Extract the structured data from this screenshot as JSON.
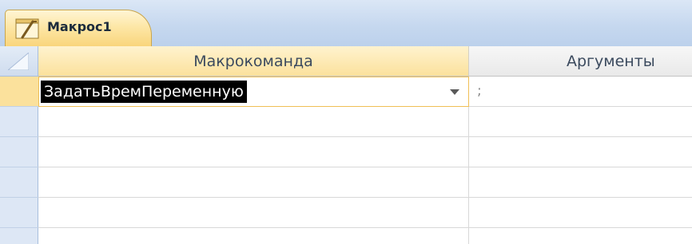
{
  "tab": {
    "title": "Макрос1",
    "icon": "macro-icon"
  },
  "columns": {
    "macro": "Макрокоманда",
    "arguments": "Аргументы"
  },
  "rows": [
    {
      "action": "ЗадатьВремПеременную",
      "arguments": ";"
    },
    {
      "action": "",
      "arguments": ""
    },
    {
      "action": "",
      "arguments": ""
    },
    {
      "action": "",
      "arguments": ""
    },
    {
      "action": "",
      "arguments": ""
    }
  ],
  "colors": {
    "tab_fill": "#fde7a7",
    "header_active": "#fbe19c",
    "tabstrip_bg": "#c6d8ef",
    "selection": "#000000"
  }
}
